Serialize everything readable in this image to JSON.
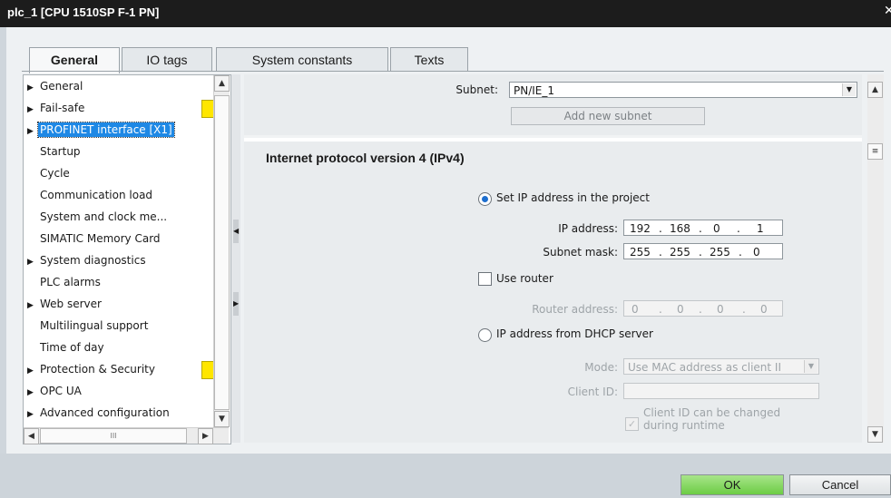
{
  "window": {
    "title": "plc_1 [CPU 1510SP F-1 PN]"
  },
  "tabs": [
    {
      "label": "General"
    },
    {
      "label": "IO tags"
    },
    {
      "label": "System constants"
    },
    {
      "label": "Texts"
    }
  ],
  "tree": {
    "items": [
      {
        "label": "General",
        "expandable": true
      },
      {
        "label": "Fail-safe",
        "expandable": true,
        "badge": true
      },
      {
        "label": "PROFINET interface [X1]",
        "expandable": true,
        "selected": true
      },
      {
        "label": "Startup"
      },
      {
        "label": "Cycle"
      },
      {
        "label": "Communication load"
      },
      {
        "label": "System and clock me..."
      },
      {
        "label": "SIMATIC Memory Card"
      },
      {
        "label": "System diagnostics",
        "expandable": true
      },
      {
        "label": "PLC alarms"
      },
      {
        "label": "Web server",
        "expandable": true
      },
      {
        "label": "Multilingual support"
      },
      {
        "label": "Time of day"
      },
      {
        "label": "Protection & Security",
        "expandable": true,
        "badge": true
      },
      {
        "label": "OPC UA",
        "expandable": true
      },
      {
        "label": "Advanced configuration",
        "expandable": true
      }
    ],
    "hscroll_grip": "III"
  },
  "subnet": {
    "label": "Subnet:",
    "value": "PN/IE_1",
    "add_button": "Add new subnet"
  },
  "ipv4": {
    "title": "Internet protocol version 4 (IPv4)",
    "set_ip_label": "Set IP address in the project",
    "ip_label": "IP address:",
    "ip": [
      "192",
      "168",
      "0",
      "1"
    ],
    "mask_label": "Subnet mask:",
    "mask": [
      "255",
      "255",
      "255",
      "0"
    ],
    "use_router_label": "Use router",
    "router_label": "Router address:",
    "router": [
      "0",
      "0",
      "0",
      "0"
    ],
    "dhcp_label": "IP address from DHCP server",
    "mode_label": "Mode:",
    "mode_value": "Use MAC address as client II",
    "client_id_label": "Client ID:",
    "client_id_value": "",
    "client_change_line1": "Client ID can be changed",
    "client_change_line2": "during runtime",
    "set_ip_selected": true,
    "use_router_checked": false
  },
  "footer": {
    "ok": "OK",
    "cancel": "Cancel"
  },
  "colors": {
    "badge": "#ffe600",
    "selection": "#1e88e5",
    "ok_green": "#6ccc45"
  }
}
